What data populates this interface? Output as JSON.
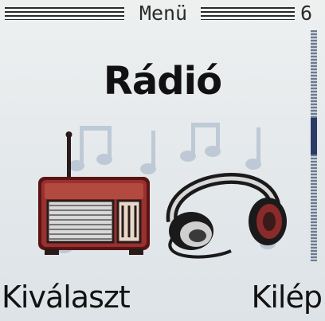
{
  "header": {
    "title": "Menü",
    "menu_number": "6"
  },
  "main": {
    "item_title": "Rádió",
    "icon": "radio-and-headphones-icon"
  },
  "softkeys": {
    "left_label": "Kiválaszt",
    "right_label": "Kilép"
  },
  "colors": {
    "background": "#e6eaec",
    "radio_body": "#8a2a2a",
    "scrollbar_thumb": "#2c3a66"
  }
}
